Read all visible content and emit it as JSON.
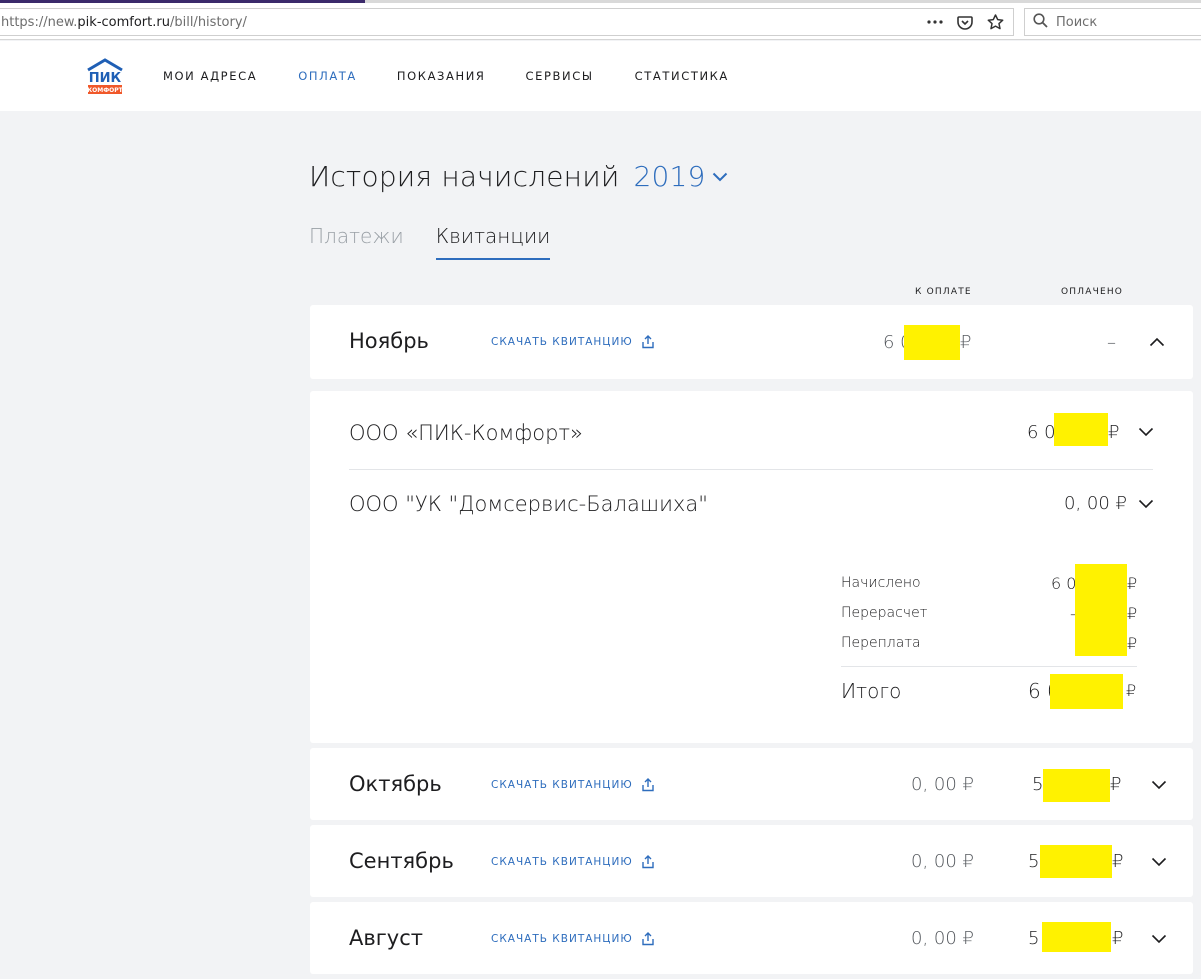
{
  "browser": {
    "url_prefix": "https://new.",
    "url_domain": "pik-comfort.ru",
    "url_path": "/bill/history/",
    "search_placeholder": "Поиск"
  },
  "logo": {
    "top": "ПИК",
    "bottom": "КОМФОРТ"
  },
  "nav": [
    {
      "label": "МОИ АДРЕСА",
      "active": false
    },
    {
      "label": "ОПЛАТА",
      "active": true
    },
    {
      "label": "ПОКАЗАНИЯ",
      "active": false
    },
    {
      "label": "СЕРВИСЫ",
      "active": false
    },
    {
      "label": "СТАТИСТИКА",
      "active": false
    }
  ],
  "title": "История начислений",
  "year": "2019",
  "tabs": [
    {
      "label": "Платежи",
      "active": false
    },
    {
      "label": "Квитанции",
      "active": true
    }
  ],
  "columns": {
    "to_pay": "К ОПЛАТЕ",
    "paid": "ОПЛАЧЕНО"
  },
  "download_label": "СКАЧАТЬ КВИТАНЦИЮ",
  "currency": "₽",
  "months": [
    {
      "name": "Ноябрь",
      "to_pay": "6 0",
      "paid": "–",
      "expanded": true
    },
    {
      "name": "Октябрь",
      "to_pay": "0, 00 ₽",
      "paid": "5",
      "expanded": false
    },
    {
      "name": "Сентябрь",
      "to_pay": "0, 00 ₽",
      "paid": "5",
      "expanded": false
    },
    {
      "name": "Август",
      "to_pay": "0, 00 ₽",
      "paid": "5",
      "expanded": false
    }
  ],
  "orgs": [
    {
      "name": "ООО «ПИК-Комфорт»",
      "amount": "6 0"
    },
    {
      "name": "ООО \"УК \"Домсервис-Балашиха\"",
      "amount": "0, 00 ₽"
    }
  ],
  "details": {
    "accrued_label": "Начислено",
    "accrued_value": "6 0",
    "recalc_label": "Перерасчет",
    "recalc_value": "-",
    "overpay_label": "Переплата",
    "overpay_value": "",
    "total_label": "Итого",
    "total_value": "6 0"
  },
  "colors": {
    "accent": "#2e6dbd",
    "redaction": "#fff200",
    "logo_blue": "#1f5fb5",
    "logo_orange": "#f0582a"
  }
}
